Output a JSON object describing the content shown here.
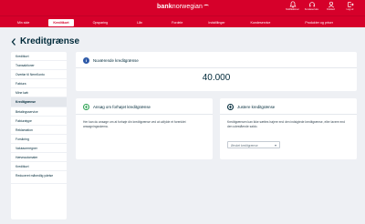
{
  "header": {
    "logo": {
      "bold": "bank",
      "rest": "norwegian"
    },
    "icons": [
      {
        "name": "notifications-icon",
        "label": "Notifikationer"
      },
      {
        "name": "customer-service-icon",
        "label": "Kundeservice"
      },
      {
        "name": "profile-icon",
        "label": "Dokked"
      },
      {
        "name": "logout-icon",
        "label": "Log ud"
      }
    ]
  },
  "nav": {
    "items": [
      {
        "label": "Min side",
        "active": false
      },
      {
        "label": "Kreditkort",
        "active": true
      },
      {
        "label": "Opsparing",
        "active": false
      },
      {
        "label": "Lån",
        "active": false
      },
      {
        "label": "Fordele",
        "active": false
      },
      {
        "label": "Indstillinger",
        "active": false
      },
      {
        "label": "Kundeservice",
        "active": false
      },
      {
        "label": "Produkter og priser",
        "active": false
      }
    ]
  },
  "page": {
    "title": "Kreditgrænse"
  },
  "sidebar": {
    "items": [
      {
        "label": "Kreditkort",
        "active": false,
        "two_line": false
      },
      {
        "label": "Transaktioner",
        "active": false,
        "two_line": false
      },
      {
        "label": "Overfør til NemKonto",
        "active": false,
        "two_line": false
      },
      {
        "label": "Faktura",
        "active": false,
        "two_line": false
      },
      {
        "label": "Mine køb",
        "active": false,
        "two_line": false
      },
      {
        "label": "Kreditgrænse",
        "active": true,
        "two_line": false
      },
      {
        "label": "Betalingsservice",
        "active": false,
        "two_line": false
      },
      {
        "label": "Fakturatype",
        "active": false,
        "two_line": false
      },
      {
        "label": "Reklamation",
        "active": false,
        "two_line": false
      },
      {
        "label": "Forsikring",
        "active": false,
        "two_line": false
      },
      {
        "label": "Valutaomregner",
        "active": false,
        "two_line": false
      },
      {
        "label": "Hæveautomater",
        "active": false,
        "two_line": false
      },
      {
        "label": "Kreditkort",
        "active": false,
        "two_line": false
      },
      {
        "label": "Reduceret månedlig ydelse",
        "active": false,
        "two_line": true
      }
    ]
  },
  "balance_card": {
    "title": "Nuværende kreditgrænse",
    "amount": "40.000",
    "accent": "#2e5aa8"
  },
  "increase_card": {
    "title": "Ansøg om forhøjet kreditgrænse",
    "body": "Her kan du ansøge om at forhøje din kreditgrænse ved at udfylde et forenklet ansøgningsskema.",
    "accent": "#2aa150"
  },
  "adjust_card": {
    "title": "Justere kreditgrænse",
    "body": "Kreditgrænsen kan ikke sættes højere end den indsigtede kreditgrænse, eller lavere end den udestående saldo.",
    "select_placeholder": "Ønsket kreditgrænse",
    "accent": "#002a3a"
  },
  "colors": {
    "brand": "#d6002a",
    "background": "#eef0f4",
    "text": "#002a3a"
  }
}
